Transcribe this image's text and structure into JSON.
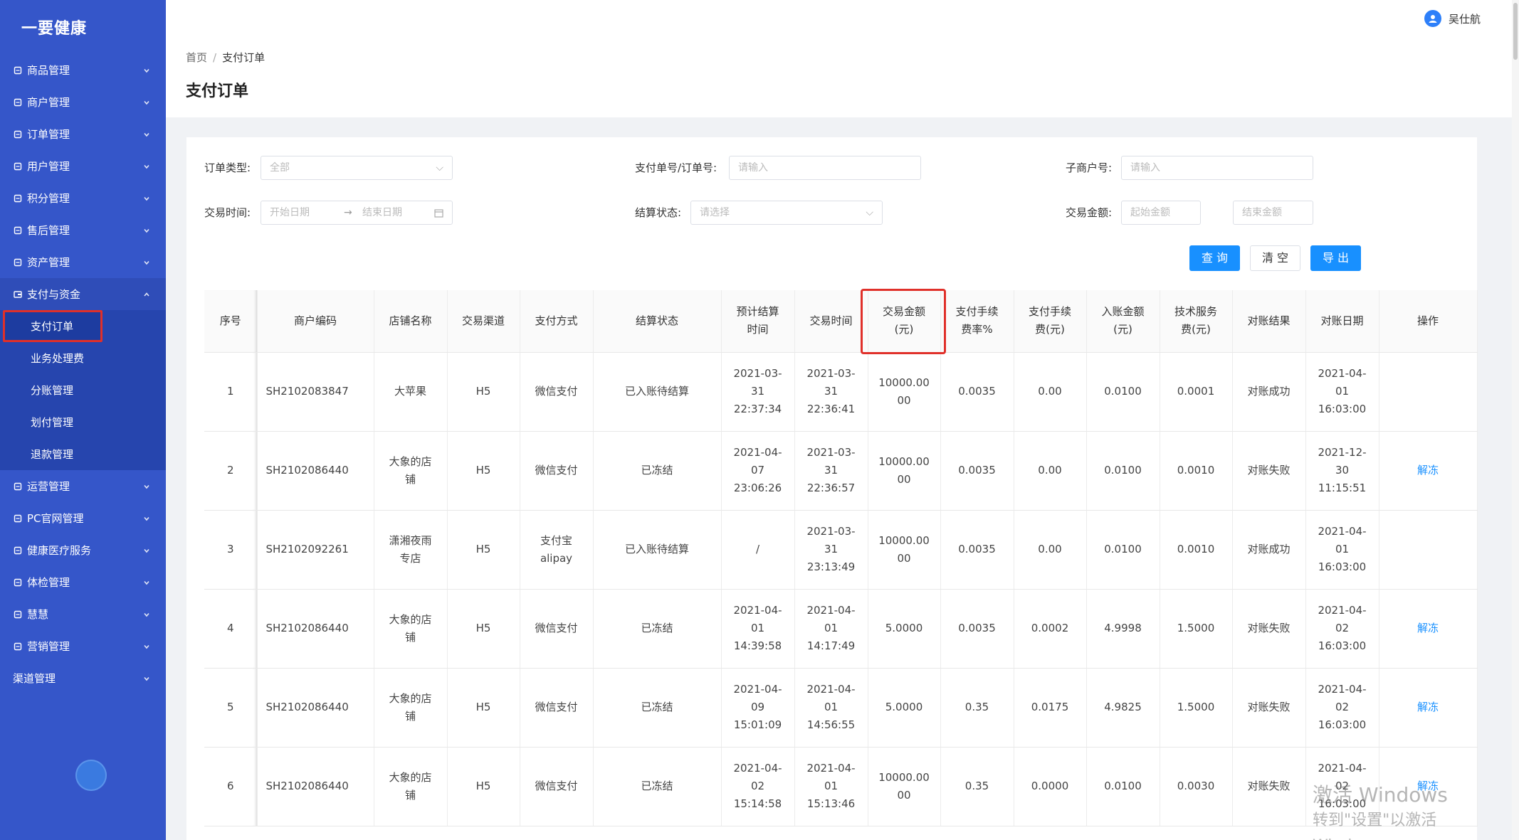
{
  "app": {
    "brand": "一要健康"
  },
  "user": {
    "name": "吴仕航"
  },
  "sidebar": {
    "items_top": [
      {
        "label": "商品管理",
        "icon": "box-icon"
      },
      {
        "label": "商户管理",
        "icon": "store-icon"
      },
      {
        "label": "订单管理",
        "icon": "order-icon"
      },
      {
        "label": "用户管理",
        "icon": "user-icon"
      },
      {
        "label": "积分管理",
        "icon": "points-icon"
      },
      {
        "label": "售后管理",
        "icon": "aftersale-icon"
      },
      {
        "label": "资产管理",
        "icon": "asset-icon"
      }
    ],
    "open_group": {
      "label": "支付与资金",
      "icon": "wallet-icon"
    },
    "sub_items": [
      "支付订单",
      "业务处理费",
      "分账管理",
      "划付管理",
      "退款管理"
    ],
    "items_bottom": [
      {
        "label": "运营管理",
        "icon": "ops-icon"
      },
      {
        "label": "PC官网管理",
        "icon": "monitor-icon"
      },
      {
        "label": "健康医疗服务",
        "icon": "medical-icon"
      },
      {
        "label": "体检管理",
        "icon": "checkup-icon"
      },
      {
        "label": "慧慧",
        "icon": "headset-icon"
      },
      {
        "label": "营销管理",
        "icon": "marketing-icon"
      },
      {
        "label": "渠道管理",
        "icon": ""
      }
    ]
  },
  "breadcrumb": {
    "home": "首页",
    "sep": "/",
    "current": "支付订单"
  },
  "page_title": "支付订单",
  "filters": {
    "order_type": {
      "label": "订单类型:",
      "value": "全部"
    },
    "pay_no": {
      "label": "支付单号/订单号:",
      "placeholder": "请输入"
    },
    "sub_merchant": {
      "label": "子商户号:",
      "placeholder": "请输入"
    },
    "trade_time": {
      "label": "交易时间:",
      "start": "开始日期",
      "arrow": "→",
      "end": "结束日期"
    },
    "settle_status": {
      "label": "结算状态:",
      "placeholder": "请选择"
    },
    "amount": {
      "label": "交易金额:",
      "min": "起始金额",
      "max": "结束金额"
    }
  },
  "buttons": {
    "query": "查 询",
    "clear": "清 空",
    "export": "导 出"
  },
  "table": {
    "headers": [
      "序号",
      "商户编码",
      "店铺名称",
      "交易渠道",
      "支付方式",
      "结算状态",
      "预计结算\n时间",
      "交易时间",
      "交易金额\n(元)",
      "支付手续\n费率%",
      "支付手续\n费(元)",
      "入账金额\n(元)",
      "技术服务\n费(元)",
      "对账结果",
      "对账日期",
      "操作"
    ],
    "rows": [
      {
        "no": "1",
        "code": "SH2102083847",
        "shop": "大苹果",
        "channel": "H5",
        "pay": "微信支付",
        "status": "已入账待结算",
        "est": "2021-03-\n31\n22:37:34",
        "time": "2021-03-\n31\n22:36:41",
        "amount": "10000.00\n00",
        "rate": "0.0035",
        "fee": "0.00",
        "income": "0.0100",
        "tech": "0.0001",
        "result": "对账成功",
        "date": "2021-04-\n01\n16:03:00",
        "op": ""
      },
      {
        "no": "2",
        "code": "SH2102086440",
        "shop": "大象的店\n铺",
        "channel": "H5",
        "pay": "微信支付",
        "status": "已冻结",
        "est": "2021-04-\n07\n23:06:26",
        "time": "2021-03-\n31\n22:36:57",
        "amount": "10000.00\n00",
        "rate": "0.0035",
        "fee": "0.00",
        "income": "0.0100",
        "tech": "0.0010",
        "result": "对账失败",
        "date": "2021-12-\n30\n11:15:51",
        "op": "解冻"
      },
      {
        "no": "3",
        "code": "SH2102092261",
        "shop": "潇湘夜雨\n专店",
        "channel": "H5",
        "pay": "支付宝\nalipay",
        "status": "已入账待结算",
        "est": "/",
        "time": "2021-03-\n31\n23:13:49",
        "amount": "10000.00\n00",
        "rate": "0.0035",
        "fee": "0.00",
        "income": "0.0100",
        "tech": "0.0010",
        "result": "对账成功",
        "date": "2021-04-\n01\n16:03:00",
        "op": ""
      },
      {
        "no": "4",
        "code": "SH2102086440",
        "shop": "大象的店\n铺",
        "channel": "H5",
        "pay": "微信支付",
        "status": "已冻结",
        "est": "2021-04-\n01\n14:39:58",
        "time": "2021-04-\n01\n14:17:49",
        "amount": "5.0000",
        "rate": "0.0035",
        "fee": "0.0002",
        "income": "4.9998",
        "tech": "1.5000",
        "result": "对账失败",
        "date": "2021-04-\n02\n16:03:00",
        "op": "解冻"
      },
      {
        "no": "5",
        "code": "SH2102086440",
        "shop": "大象的店\n铺",
        "channel": "H5",
        "pay": "微信支付",
        "status": "已冻结",
        "est": "2021-04-\n09\n15:01:09",
        "time": "2021-04-\n01\n14:56:55",
        "amount": "5.0000",
        "rate": "0.35",
        "fee": "0.0175",
        "income": "4.9825",
        "tech": "1.5000",
        "result": "对账失败",
        "date": "2021-04-\n02\n16:03:00",
        "op": "解冻"
      },
      {
        "no": "6",
        "code": "SH2102086440",
        "shop": "大象的店\n铺",
        "channel": "H5",
        "pay": "微信支付",
        "status": "已冻结",
        "est": "2021-04-\n02\n15:14:58",
        "time": "2021-04-\n01\n15:13:46",
        "amount": "10000.00\n00",
        "rate": "0.35",
        "fee": "0.0000",
        "income": "0.0100",
        "tech": "0.0030",
        "result": "对账失败",
        "date": "2021-04-\n02\n16:03:00",
        "op": "解冻"
      }
    ]
  },
  "watermark": {
    "line1": "激活 Windows",
    "line2": "转到\"设置\"以激活 Windows。"
  },
  "colors": {
    "sidebar": "#3556c9",
    "primary": "#1890ff",
    "highlight": "#e0302a"
  }
}
